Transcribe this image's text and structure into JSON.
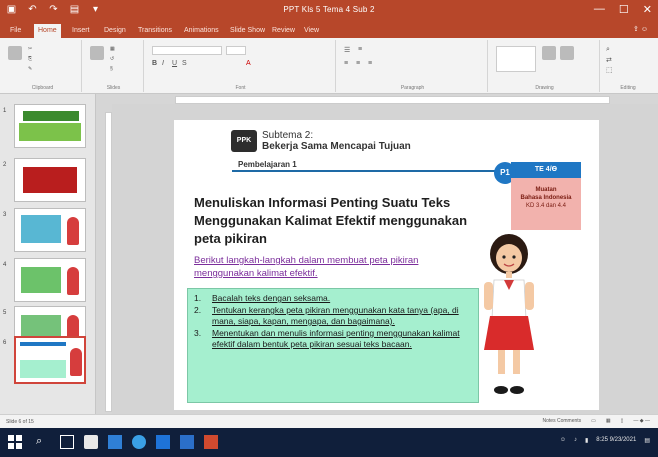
{
  "window": {
    "title": "PPT Kls 5 Tema 4 Sub 2",
    "controls": [
      "—",
      "☐",
      "✕"
    ]
  },
  "ribbon_tabs": [
    {
      "label": "File",
      "active": false
    },
    {
      "label": "Home",
      "active": true
    },
    {
      "label": "Insert",
      "active": false
    },
    {
      "label": "Design",
      "active": false
    },
    {
      "label": "Transitions",
      "active": false
    },
    {
      "label": "Animations",
      "active": false
    },
    {
      "label": "Slide Show",
      "active": false
    },
    {
      "label": "Review",
      "active": false
    },
    {
      "label": "View",
      "active": false
    }
  ],
  "ribbon_groups": [
    {
      "label": "Clipboard"
    },
    {
      "label": "Slides"
    },
    {
      "label": "Font"
    },
    {
      "label": "Paragraph"
    },
    {
      "label": "Drawing"
    },
    {
      "label": "Editing"
    }
  ],
  "slide_thumbnails": [
    {
      "number": "1",
      "selected": false,
      "color": "#7cc24a"
    },
    {
      "number": "2",
      "selected": false,
      "color": "#b91e1e"
    },
    {
      "number": "3",
      "selected": false,
      "color": "#58b7d3"
    },
    {
      "number": "4",
      "selected": false,
      "color": "#6cc26a"
    },
    {
      "number": "5",
      "selected": false,
      "color": "#75c27a"
    },
    {
      "number": "6",
      "selected": true,
      "color": "#a5efcf"
    }
  ],
  "slide": {
    "subtema_icon": "PPK",
    "subtema_line1": "Subtema 2:",
    "subtema_line2": "Bekerja Sama Mencapai Tujuan",
    "pembelajaran": "Pembelajaran 1",
    "p_badge": "P1",
    "tema_label": "TE 4/Ѳ",
    "muatan_title": "Muatan",
    "muatan_subject": "Bahasa Indonesia",
    "muatan_kd": "KD 3.4 dan 4.4",
    "heading": "Menuliskan Informasi Penting Suatu Teks Menggunakan Kalimat Efektif menggunakan peta pikiran",
    "intro": "Berikut langkah-langkah dalam membuat peta pikiran menggunakan kalimat efektif.",
    "steps": [
      {
        "n": "1.",
        "text": "Bacalah teks dengan seksama."
      },
      {
        "n": "2.",
        "text": "Tentukan kerangka peta pikiran menggunakan kata tanya (apa, di mana, siapa, kapan, mengapa, dan bagaimana)."
      },
      {
        "n": "3.",
        "text": "Menentukan dan menulis informasi penting menggunakan kalimat efektif dalam bentuk peta pikiran sesuai teks bacaan."
      }
    ]
  },
  "statusbar": {
    "left": "Slide 6 of 15",
    "right": "Notes   Comments"
  },
  "taskbar": {
    "time": "8:25",
    "date": "9/23/2021"
  }
}
